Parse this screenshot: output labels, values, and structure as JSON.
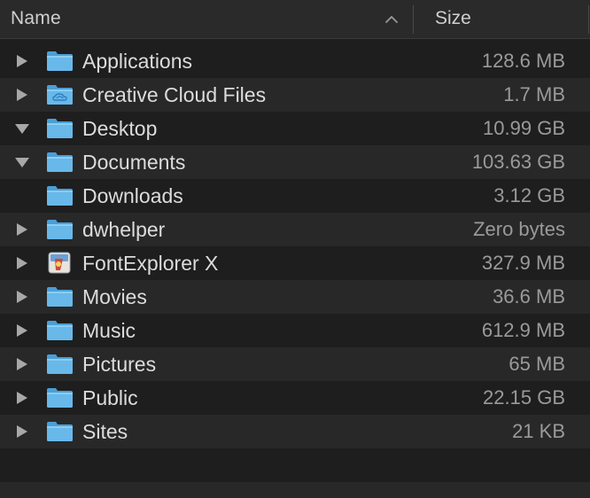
{
  "header": {
    "name_label": "Name",
    "size_label": "Size",
    "sort_icon": "chevron-up-icon"
  },
  "colors": {
    "background": "#1e1e1e",
    "alt_row": "#282828",
    "header_bg": "#2a2a2a",
    "folder_blue": "#5fb4e6",
    "name_text": "#dcdcdc",
    "size_text": "#9a9a9a"
  },
  "rows": [
    {
      "name": "Applications",
      "size": "128.6 MB",
      "disclosure": "collapsed",
      "icon": "folder-icon"
    },
    {
      "name": "Creative Cloud Files",
      "size": "1.7 MB",
      "disclosure": "collapsed",
      "icon": "creative-cloud-folder-icon"
    },
    {
      "name": "Desktop",
      "size": "10.99 GB",
      "disclosure": "expanded",
      "icon": "folder-icon"
    },
    {
      "name": "Documents",
      "size": "103.63 GB",
      "disclosure": "expanded",
      "icon": "folder-icon"
    },
    {
      "name": "Downloads",
      "size": "3.12 GB",
      "disclosure": "none",
      "icon": "folder-icon"
    },
    {
      "name": "dwhelper",
      "size": "Zero bytes",
      "disclosure": "collapsed",
      "icon": "folder-icon"
    },
    {
      "name": "FontExplorer X",
      "size": "327.9 MB",
      "disclosure": "collapsed",
      "icon": "fontexplorer-app-icon"
    },
    {
      "name": "Movies",
      "size": "36.6 MB",
      "disclosure": "collapsed",
      "icon": "folder-icon"
    },
    {
      "name": "Music",
      "size": "612.9 MB",
      "disclosure": "collapsed",
      "icon": "folder-icon"
    },
    {
      "name": "Pictures",
      "size": "65 MB",
      "disclosure": "collapsed",
      "icon": "folder-icon"
    },
    {
      "name": "Public",
      "size": "22.15 GB",
      "disclosure": "collapsed",
      "icon": "folder-icon"
    },
    {
      "name": "Sites",
      "size": "21 KB",
      "disclosure": "collapsed",
      "icon": "folder-icon"
    }
  ]
}
